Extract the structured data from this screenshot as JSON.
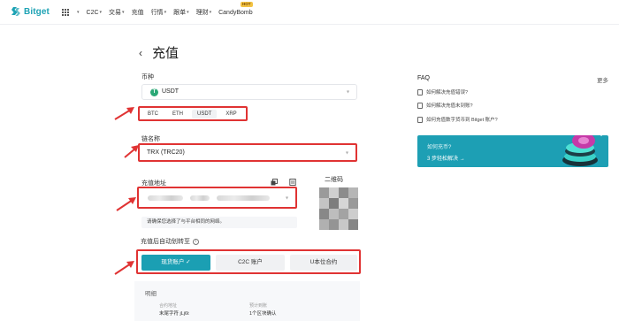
{
  "nav": {
    "logo": "Bitget",
    "items": [
      {
        "label": "C2C",
        "caret": true
      },
      {
        "label": "交易",
        "caret": true
      },
      {
        "label": "充值",
        "caret": false
      },
      {
        "label": "行情",
        "caret": true
      },
      {
        "label": "跟单",
        "caret": true
      },
      {
        "label": "理财",
        "caret": true
      },
      {
        "label": "CandyBomb",
        "caret": false
      }
    ],
    "hot_badge": "HOT"
  },
  "page": {
    "back_icon": "‹",
    "title": "充值"
  },
  "form": {
    "coin_label": "币种",
    "coin_value": "USDT",
    "coin_badge": "T",
    "quick_coins": [
      "BTC",
      "ETH",
      "USDT",
      "XRP"
    ],
    "quick_coin_selected": "USDT",
    "network_label": "链名称",
    "network_value": "TRX (TRC20)",
    "address_label": "充值地址",
    "address_hint": "请确保您选择了与平台相同的网络。",
    "qr_label": "二维码",
    "auto_transfer_label": "充值后自动划转至",
    "accounts": [
      {
        "label": "现货账户",
        "selected": true
      },
      {
        "label": "C2C 账户",
        "selected": false
      },
      {
        "label": "U本位合约",
        "selected": false
      }
    ],
    "check_mark": "✓",
    "info_glyph": "i"
  },
  "details": {
    "title": "明细",
    "items": [
      {
        "key": "合约地址",
        "value": "末尾字符 jLj6t"
      },
      {
        "key": "预计到账",
        "value": "1个区块确认"
      }
    ]
  },
  "faq": {
    "title": "FAQ",
    "more": "更多",
    "items": [
      "如何解决充值错误?",
      "如何解决充值未到账?",
      "如何充值数字货币到 Bitget 账户?"
    ],
    "banner_title": "如何充币?",
    "banner_link": "3 步轻松解决",
    "banner_arrow": "→"
  },
  "colors": {
    "brand": "#1da2b4",
    "highlight": "#e03333",
    "selected": "#1b9fb3"
  }
}
